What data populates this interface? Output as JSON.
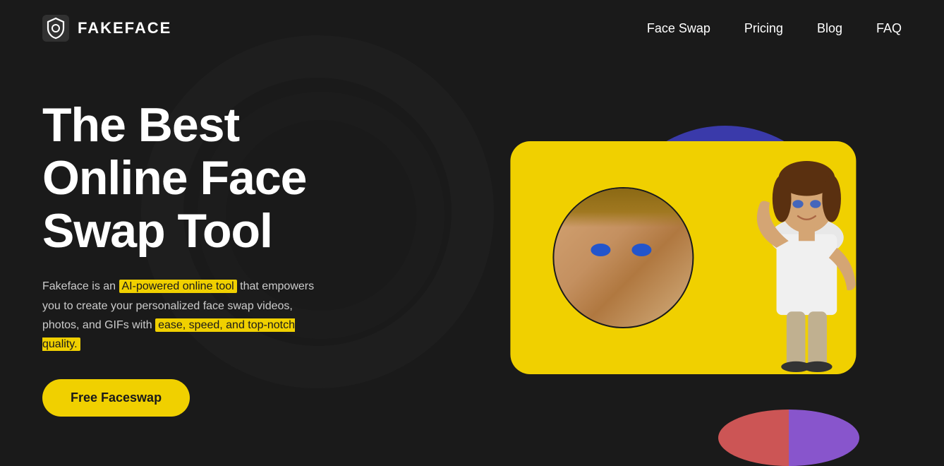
{
  "brand": {
    "name": "FAKEFACE",
    "icon_label": "shield-face-icon"
  },
  "nav": {
    "items": [
      {
        "label": "Face Swap",
        "id": "nav-face-swap"
      },
      {
        "label": "Pricing",
        "id": "nav-pricing"
      },
      {
        "label": "Blog",
        "id": "nav-blog"
      },
      {
        "label": "FAQ",
        "id": "nav-faq"
      }
    ]
  },
  "hero": {
    "title": "The Best Online Face Swap Tool",
    "description_part1": "Fakeface is an ",
    "highlight1": "AI-powered online tool",
    "description_part2": " that empowers you to create your personalized face swap videos, photos, and GIFs with ",
    "highlight2": "ease, speed, and top-notch quality.",
    "cta_label": "Free Faceswap"
  },
  "colors": {
    "background": "#1a1a1a",
    "accent_yellow": "#f0d000",
    "text_white": "#ffffff",
    "text_gray": "#cccccc",
    "ring_blue": "#3a3aaa",
    "ring_red": "#c85a5a",
    "ring_purple": "#8855cc"
  }
}
